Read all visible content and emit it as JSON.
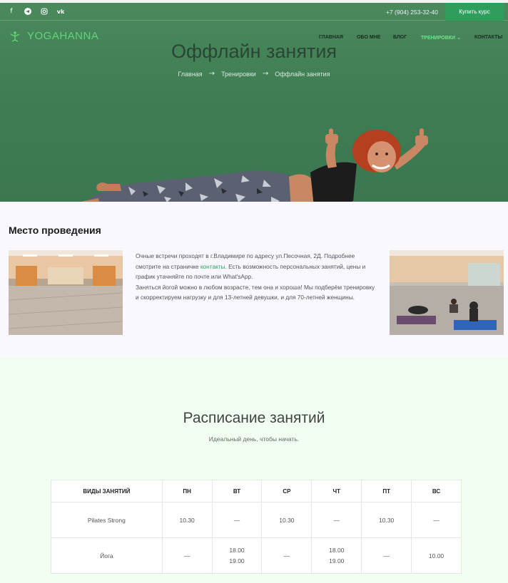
{
  "topbar": {
    "social_icons": [
      "facebook-icon",
      "telegram-icon",
      "instagram-icon",
      "vk-icon"
    ],
    "social_glyphs": [
      "f",
      "◢",
      "◎",
      "vk"
    ],
    "phone": "+7 (904) 253-32-40",
    "buy_button": "Купить курс"
  },
  "logo": {
    "text": "YOGAHANNA"
  },
  "nav": {
    "items": [
      {
        "label": "ГЛАВНАЯ"
      },
      {
        "label": "ОБО МНЕ"
      },
      {
        "label": "БЛОГ"
      },
      {
        "label": "ТРЕНИРОВКИ ⌄"
      },
      {
        "label": "КОНТАКТЫ"
      }
    ]
  },
  "hero": {
    "title": "Оффлайн занятия",
    "breadcrumb": [
      "Главная",
      "Тренировки",
      "Оффлайн занятия"
    ]
  },
  "venue": {
    "title": "Место проведения",
    "text_part1": "Очные встречи проходят в г.Владимире по адресу ул.Песочная, 2Д. Подробнее смотрите на страничке ",
    "link": "контакты",
    "text_part2": ". Есть возможность персональных занятий, цены и график утачняйте по почте или What'sApp.",
    "text_p2": "Заняться йогой можно в любом возрасте, тем она и хороша! Мы подберём тренировку и скорректируем нагрузку и для 13-летней девушки, и для 70-летней женщины."
  },
  "schedule": {
    "title": "Расписание занятий",
    "subtitle": "Идеальный день, чтобы начать.",
    "headers": [
      "ВИДЫ ЗАНЯТИЙ",
      "ПН",
      "ВТ",
      "СР",
      "ЧТ",
      "ПТ",
      "ВС"
    ],
    "rows": [
      {
        "name": "Pilates Strong",
        "cells": [
          [
            "10.30"
          ],
          [
            "—"
          ],
          [
            "10.30"
          ],
          [
            "—"
          ],
          [
            "10.30"
          ],
          [
            "—"
          ]
        ]
      },
      {
        "name": "Йога",
        "cells": [
          [
            "—"
          ],
          [
            "18.00",
            "19.00"
          ],
          [
            "—"
          ],
          [
            "18.00",
            "19.00"
          ],
          [
            "—"
          ],
          [
            "10.00"
          ]
        ]
      }
    ]
  },
  "colors": {
    "accent": "#2f9e5c",
    "hero_green": "#3f7d54",
    "logo_green": "#5fd47a"
  }
}
